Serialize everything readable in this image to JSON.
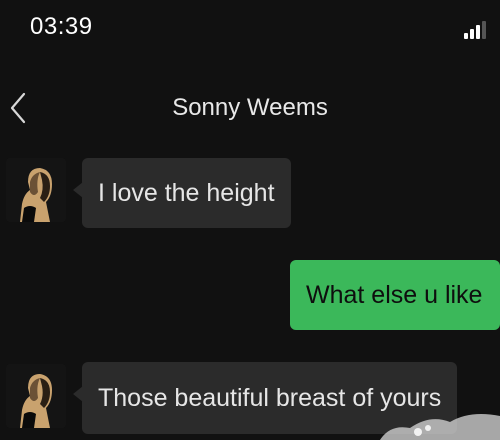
{
  "status_bar": {
    "time": "03:39"
  },
  "header": {
    "contact_name": "Sonny Weems"
  },
  "messages": [
    {
      "sender": "contact",
      "text": "I love the height"
    },
    {
      "sender": "me",
      "text": "What else u like"
    },
    {
      "sender": "contact",
      "text": "Those beautiful breast of yours"
    }
  ],
  "colors": {
    "background": "#111111",
    "incoming_bubble": "#2b2b2b",
    "outgoing_bubble": "#3bb85a",
    "signal_active": "#ffffff",
    "signal_inactive": "#555555"
  },
  "icons": {
    "back": "chevron-left-icon",
    "signal": "cellular-signal-icon",
    "avatar": "contact-avatar-portrait"
  }
}
